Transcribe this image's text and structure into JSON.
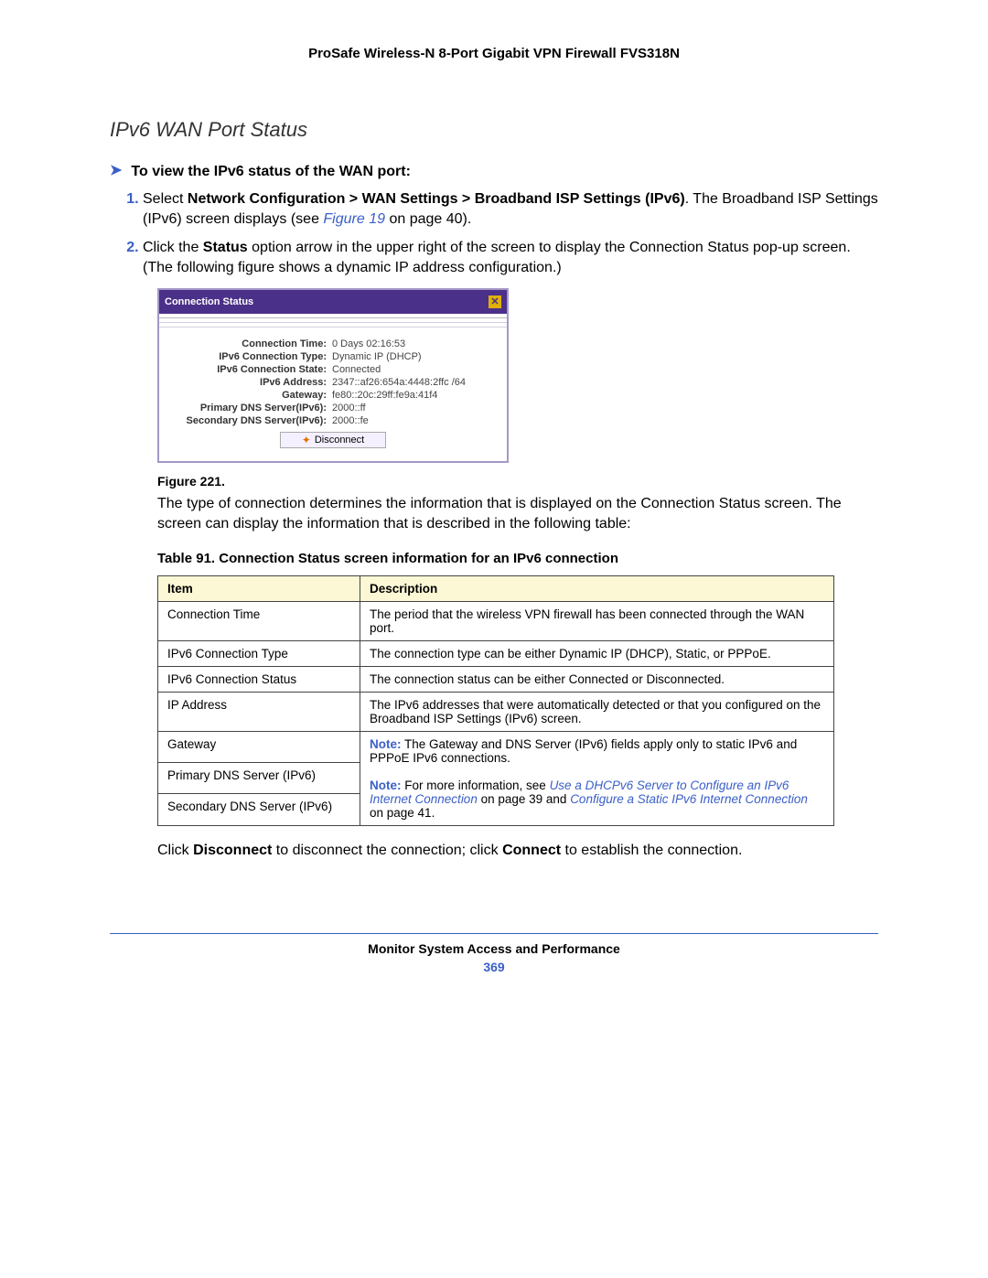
{
  "header": "ProSafe Wireless-N 8-Port Gigabit VPN Firewall FVS318N",
  "section_title": "IPv6 WAN Port Status",
  "arrow_label": "To view the IPv6 status of the WAN port:",
  "step1_prefix": "Select ",
  "step1_bold": "Network Configuration > WAN Settings > Broadband ISP Settings (IPv6)",
  "step1_post": ". The Broadband ISP Settings (IPv6) screen displays (see ",
  "step1_figref": "Figure 19",
  "step1_tail": " on page 40).",
  "step2_prefix": "Click the ",
  "step2_bold": "Status",
  "step2_post": " option arrow in the upper right of the screen to display the Connection Status pop-up screen. (The following figure shows a dynamic IP address configuration.)",
  "popup": {
    "title": "Connection Status",
    "rows": {
      "conn_time_k": "Connection Time:",
      "conn_time_v": "0 Days 02:16:53",
      "conn_type_k": "IPv6 Connection Type:",
      "conn_type_v": "Dynamic IP (DHCP)",
      "conn_state_k": "IPv6 Connection State:",
      "conn_state_v": "Connected",
      "ipv6_addr_k": "IPv6 Address:",
      "ipv6_addr_v": "2347::af26:654a:4448:2ffc /64",
      "gateway_k": "Gateway:",
      "gateway_v": "fe80::20c:29ff:fe9a:41f4",
      "pdns_k": "Primary DNS Server(IPv6):",
      "pdns_v": "2000::ff",
      "sdns_k": "Secondary DNS Server(IPv6):",
      "sdns_v": "2000::fe"
    },
    "disconnect_label": "Disconnect"
  },
  "figure_caption": "Figure 221.",
  "post_figure_para": "The type of connection determines the information that is displayed on the Connection Status screen. The screen can display the information that is described in the following table:",
  "table_caption": "Table 91.  Connection Status screen information for an IPv6 connection",
  "table": {
    "h_item": "Item",
    "h_desc": "Description",
    "r1_i": "Connection Time",
    "r1_d": "The period that the wireless VPN firewall has been connected through the WAN port.",
    "r2_i": "IPv6 Connection Type",
    "r2_d": "The connection type can be either Dynamic IP (DHCP), Static, or PPPoE.",
    "r3_i": "IPv6 Connection Status",
    "r3_d": "The connection status can be either Connected or Disconnected.",
    "r4_i": "IP Address",
    "r4_d": "The IPv6 addresses that were automatically detected or that you configured on the Broadband ISP Settings (IPv6) screen.",
    "r5_i": "Gateway",
    "r6_i": "Primary DNS Server (IPv6)",
    "r7_i": "Secondary DNS Server (IPv6)",
    "note1_head": "Note:",
    "note1_body": "  The Gateway and DNS Server (IPv6) fields apply only to static IPv6 and PPPoE IPv6 connections.",
    "note2_head": "Note:",
    "note2_body_pre": "  For more information, see ",
    "note2_link1": "Use a DHCPv6 Server to Configure an IPv6 Internet Connection",
    "note2_mid": " on page 39 and ",
    "note2_link2": "Configure a Static IPv6 Internet Connection",
    "note2_tail": " on page 41."
  },
  "final_para": {
    "pre": "Click ",
    "b1": "Disconnect",
    "mid": " to disconnect the connection; click ",
    "b2": "Connect",
    "post": " to establish the connection."
  },
  "footer_title": "Monitor System Access and Performance",
  "footer_page": "369"
}
